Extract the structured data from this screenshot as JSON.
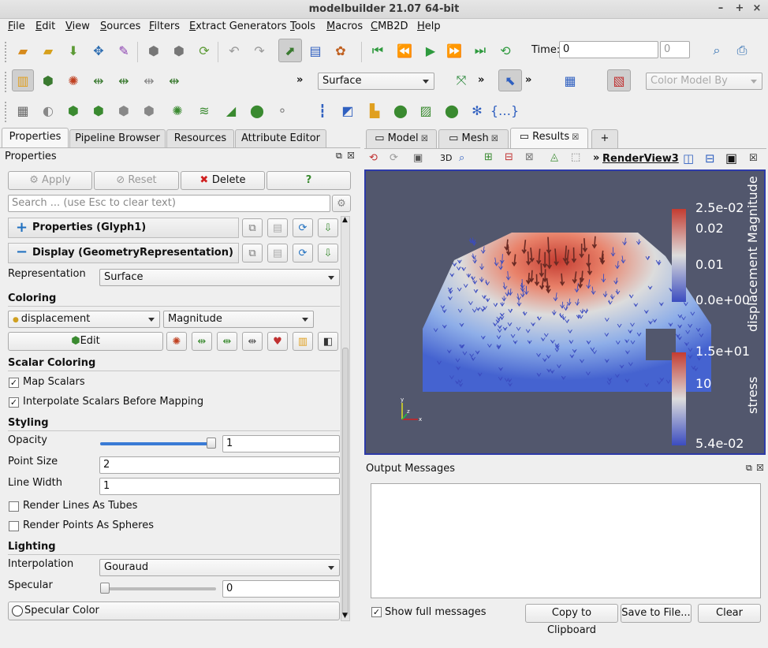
{
  "window": {
    "title": "modelbuilder 21.07 64-bit"
  },
  "menu": [
    "File",
    "Edit",
    "View",
    "Sources",
    "Filters",
    "Extract Generators",
    "Tools",
    "Macros",
    "CMB2D",
    "Help"
  ],
  "toolbar": {
    "time_label": "Time:",
    "time_value": "0",
    "timestep_value": "0",
    "representation": "Surface",
    "color_model_placeholder": "Color Model By"
  },
  "left_tabs": [
    "Properties",
    "Pipeline Browser",
    "Resources",
    "Attribute Editor"
  ],
  "properties": {
    "panel_title": "Properties",
    "apply": "Apply",
    "reset": "Reset",
    "delete": "Delete",
    "help": "?",
    "search_placeholder": "Search ... (use Esc to clear text)",
    "group1": "Properties (Glyph1)",
    "group2": "Display (GeometryRepresentation)",
    "representation_label": "Representation",
    "representation_value": "Surface",
    "coloring_title": "Coloring",
    "coloring_array": "displacement",
    "coloring_component": "Magnitude",
    "edit": "Edit",
    "scalar_title": "Scalar Coloring",
    "map_scalars": "Map Scalars",
    "interpolate": "Interpolate Scalars Before Mapping",
    "styling_title": "Styling",
    "opacity_label": "Opacity",
    "opacity_value": "1",
    "opacity_level": 1.0,
    "point_size_label": "Point Size",
    "point_size_value": "2",
    "line_width_label": "Line Width",
    "line_width_value": "1",
    "tubes": "Render Lines As Tubes",
    "spheres": "Render Points As Spheres",
    "lighting_title": "Lighting",
    "interp_label": "Interpolation",
    "interp_value": "Gouraud",
    "specular_label": "Specular",
    "specular_value": "0",
    "specular_level": 0.0,
    "specular_color": "Specular Color"
  },
  "view_tabs": [
    "Model",
    "Mesh",
    "Results",
    "+"
  ],
  "render": {
    "view_name": "RenderView3",
    "btn3d": "3D",
    "bar1_title": "displacement Magnitude",
    "bar1_ticks": [
      "2.5e-02",
      "0.02",
      "0.01",
      "0.0e+00"
    ],
    "bar2_title": "stress",
    "bar2_ticks": [
      "1.5e+01",
      "10",
      "5.4e-02"
    ],
    "axes": {
      "x": "x",
      "y": "y",
      "z": "z"
    },
    "colors": {
      "bg": "#52576d",
      "high": "#c43c31",
      "mid": "#dcdcdc",
      "low": "#3b4cc0"
    }
  },
  "output": {
    "title": "Output Messages",
    "show_full": "Show full messages",
    "copy": "Copy to Clipboard",
    "save": "Save to File...",
    "clear": "Clear"
  }
}
